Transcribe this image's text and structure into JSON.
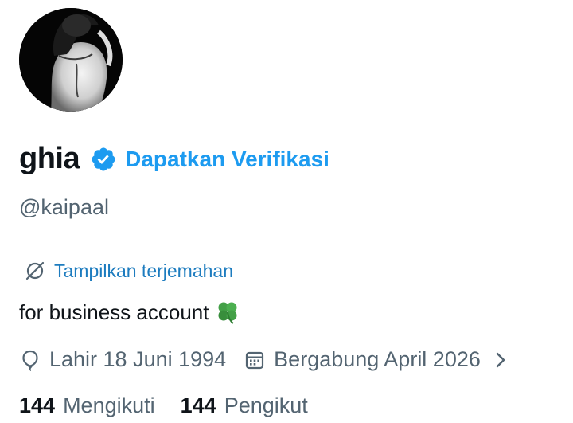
{
  "profile": {
    "display_name": "ghia",
    "verify_link": "Dapatkan Verifikasi",
    "handle": "@kaipaal",
    "translate_label": "Tampilkan terjemahan",
    "bio": "for business account",
    "birth": "Lahir 18 Juni 1994",
    "joined": "Bergabung April 2026",
    "following_count": "144",
    "following_label": "Mengikuti",
    "followers_count": "144",
    "followers_label": "Pengikut"
  },
  "icons": {
    "verified": "verified-badge-icon",
    "translate": "translate-icon",
    "bio_emoji": "four-leaf-clover-icon",
    "birth": "balloon-icon",
    "joined": "calendar-icon",
    "more": "chevron-right-icon"
  },
  "colors": {
    "accent": "#1d9bf0",
    "secondary_text": "#536471",
    "primary_text": "#0f1419"
  }
}
